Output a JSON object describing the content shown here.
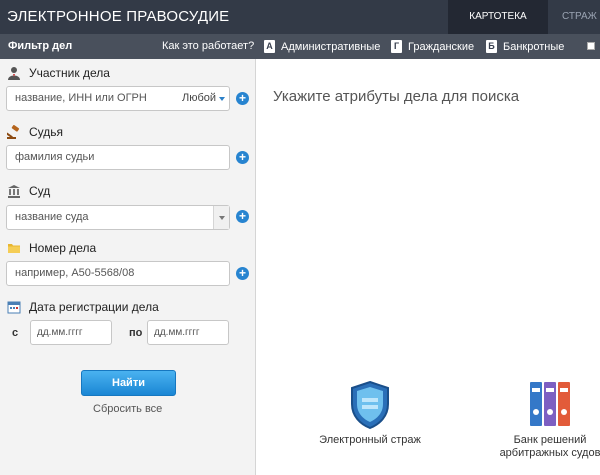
{
  "header": {
    "brand": "ЭЛЕКТРОННОЕ ПРАВОСУДИЕ",
    "tabs": [
      {
        "label": "КАРТОТЕКА",
        "active": true
      },
      {
        "label": "СТРАЖ",
        "active": false
      }
    ]
  },
  "filterbar": {
    "title": "Фильтр дел",
    "how_link": "Как это работает?",
    "types": [
      {
        "badge": "А",
        "label": "Административные"
      },
      {
        "badge": "Г",
        "label": "Гражданские"
      },
      {
        "badge": "Б",
        "label": "Банкротные"
      }
    ]
  },
  "form": {
    "participant": {
      "label": "Участник дела",
      "placeholder": "название, ИНН или ОГРН",
      "role": "Любой"
    },
    "judge": {
      "label": "Судья",
      "placeholder": "фамилия судьи"
    },
    "court": {
      "label": "Суд",
      "placeholder": "название суда"
    },
    "case_number": {
      "label": "Номер дела",
      "placeholder": "например, А50-5568/08"
    },
    "reg_date": {
      "label": "Дата регистрации дела",
      "from_label": "с",
      "to_label": "по",
      "from_placeholder": "дд.мм.гггг",
      "to_placeholder": "дд.мм.гггг"
    },
    "submit_label": "Найти",
    "reset_label": "Сбросить все"
  },
  "main": {
    "hint": "Укажите атрибуты дела для поиска",
    "promos": [
      {
        "label": "Электронный страж"
      },
      {
        "label_line1": "Банк решений",
        "label_line2": "арбитражных судов"
      }
    ]
  },
  "colors": {
    "topbar": "#333a47",
    "filterbar": "#49505c",
    "accent": "#2784d0"
  }
}
